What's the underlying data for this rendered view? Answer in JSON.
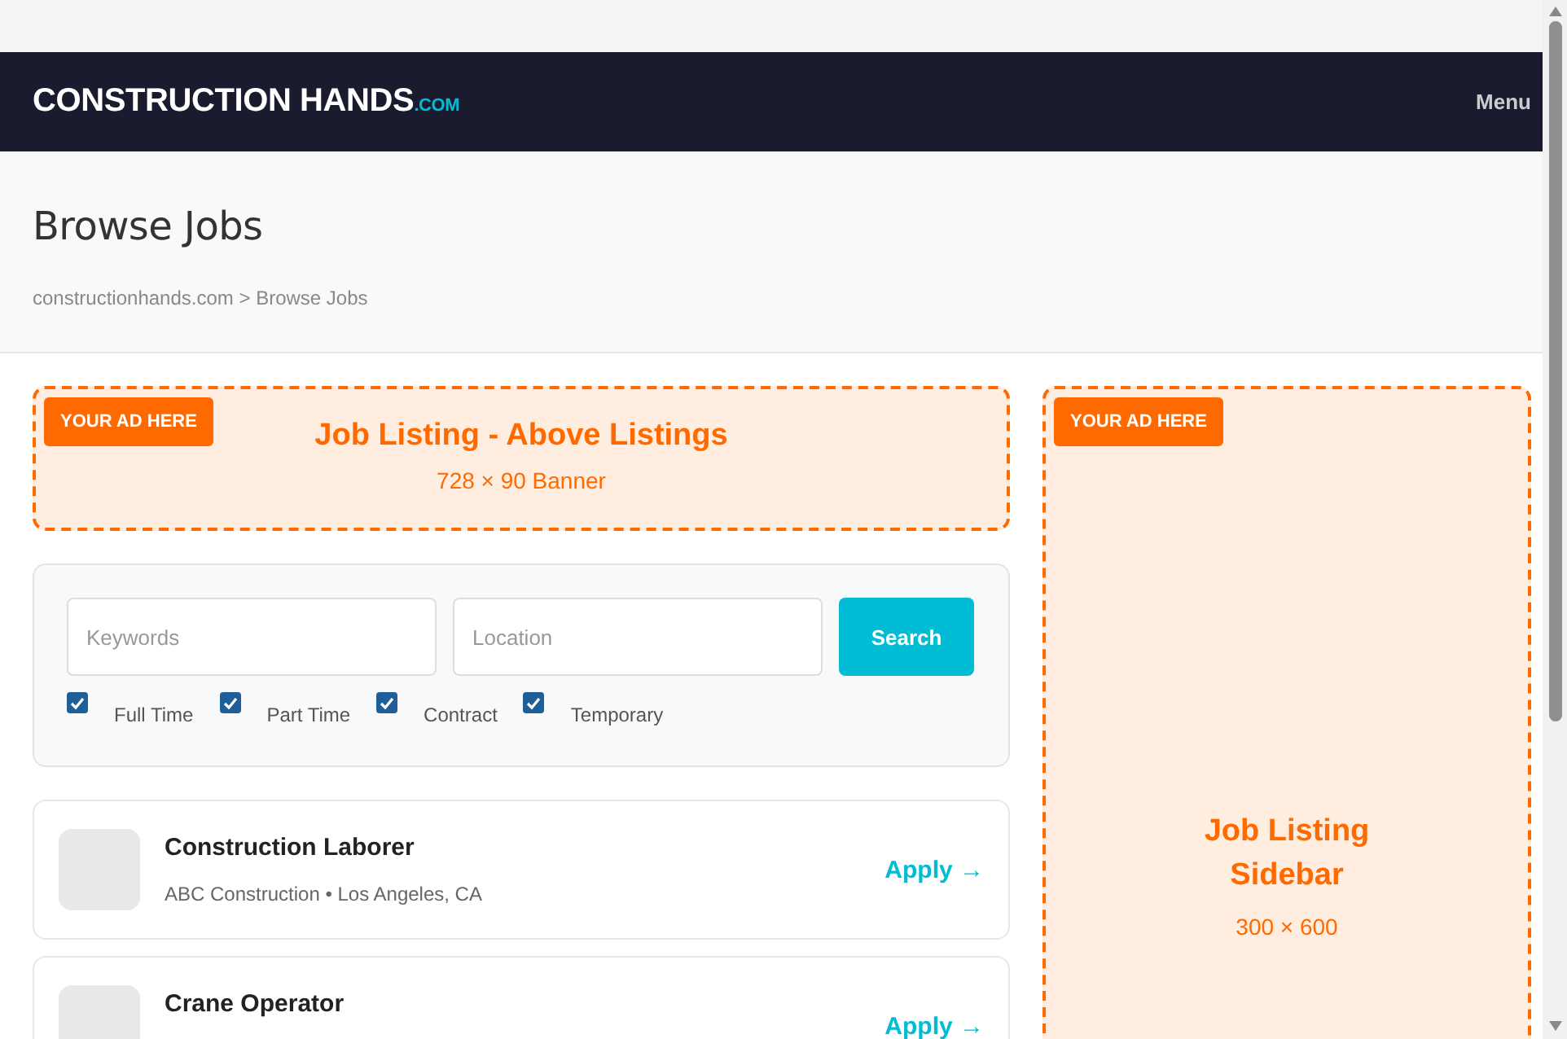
{
  "header": {
    "logo": "CONSTRUCTION HANDS",
    "logo_suffix": ".COM",
    "menu": "Menu"
  },
  "hero": {
    "title": "Browse Jobs",
    "breadcrumb": "constructionhands.com > Browse Jobs"
  },
  "banner_ad": {
    "badge": "YOUR AD HERE",
    "title": "Job Listing - Above Listings",
    "size": "728 × 90 Banner"
  },
  "search": {
    "keywords": {
      "placeholder": "Keywords"
    },
    "location": {
      "placeholder": "Location"
    },
    "button": "Search",
    "filters": [
      {
        "label": "Full Time",
        "checked": true
      },
      {
        "label": "Part Time",
        "checked": true
      },
      {
        "label": "Contract",
        "checked": true
      },
      {
        "label": "Temporary",
        "checked": true
      }
    ]
  },
  "jobs": [
    {
      "title": "Construction Laborer",
      "meta": "ABC Construction • Los Angeles, CA",
      "action": "Apply →"
    },
    {
      "title": "Crane Operator",
      "action": "Apply →"
    }
  ],
  "sidebar_ad": {
    "badge": "YOUR AD HERE",
    "title": "Job Listing Sidebar",
    "size": "300 × 600"
  }
}
